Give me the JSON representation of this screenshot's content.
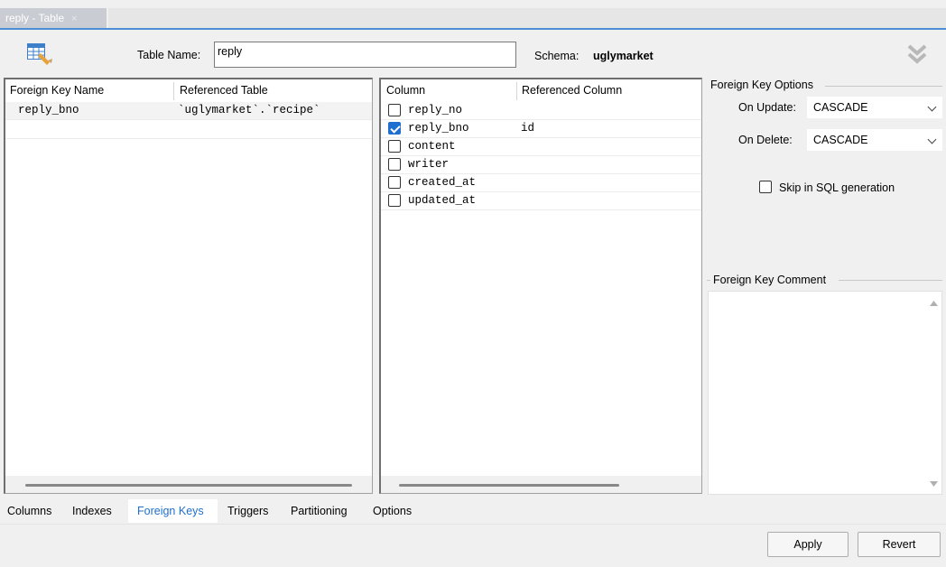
{
  "document_tab": {
    "title": "reply - Table",
    "close": "×"
  },
  "header": {
    "table_name_label": "Table Name:",
    "table_name_value": "reply",
    "schema_label": "Schema:",
    "schema_value": "uglymarket"
  },
  "fk_list": {
    "columns": [
      "Foreign Key Name",
      "Referenced Table"
    ],
    "rows": [
      {
        "name": "reply_bno",
        "referenced_table": "`uglymarket`.`recipe`"
      }
    ]
  },
  "column_list": {
    "columns": [
      "Column",
      "Referenced Column"
    ],
    "rows": [
      {
        "column": "reply_no",
        "checked": false,
        "referenced": ""
      },
      {
        "column": "reply_bno",
        "checked": true,
        "referenced": "id"
      },
      {
        "column": "content",
        "checked": false,
        "referenced": ""
      },
      {
        "column": "writer",
        "checked": false,
        "referenced": ""
      },
      {
        "column": "created_at",
        "checked": false,
        "referenced": ""
      },
      {
        "column": "updated_at",
        "checked": false,
        "referenced": ""
      }
    ]
  },
  "fk_options": {
    "title": "Foreign Key Options",
    "on_update_label": "On Update:",
    "on_update_value": "CASCADE",
    "on_delete_label": "On Delete:",
    "on_delete_value": "CASCADE",
    "skip_label": "Skip in SQL generation",
    "skip_checked": false
  },
  "fk_comment": {
    "title": "Foreign Key Comment",
    "value": ""
  },
  "bottom_tabs": [
    "Columns",
    "Indexes",
    "Foreign Keys",
    "Triggers",
    "Partitioning",
    "Options"
  ],
  "active_bottom_tab": "Foreign Keys",
  "buttons": {
    "apply": "Apply",
    "revert": "Revert"
  },
  "colors": {
    "accent": "#1e6fd0",
    "tab_underline": "#4a8fd6"
  }
}
